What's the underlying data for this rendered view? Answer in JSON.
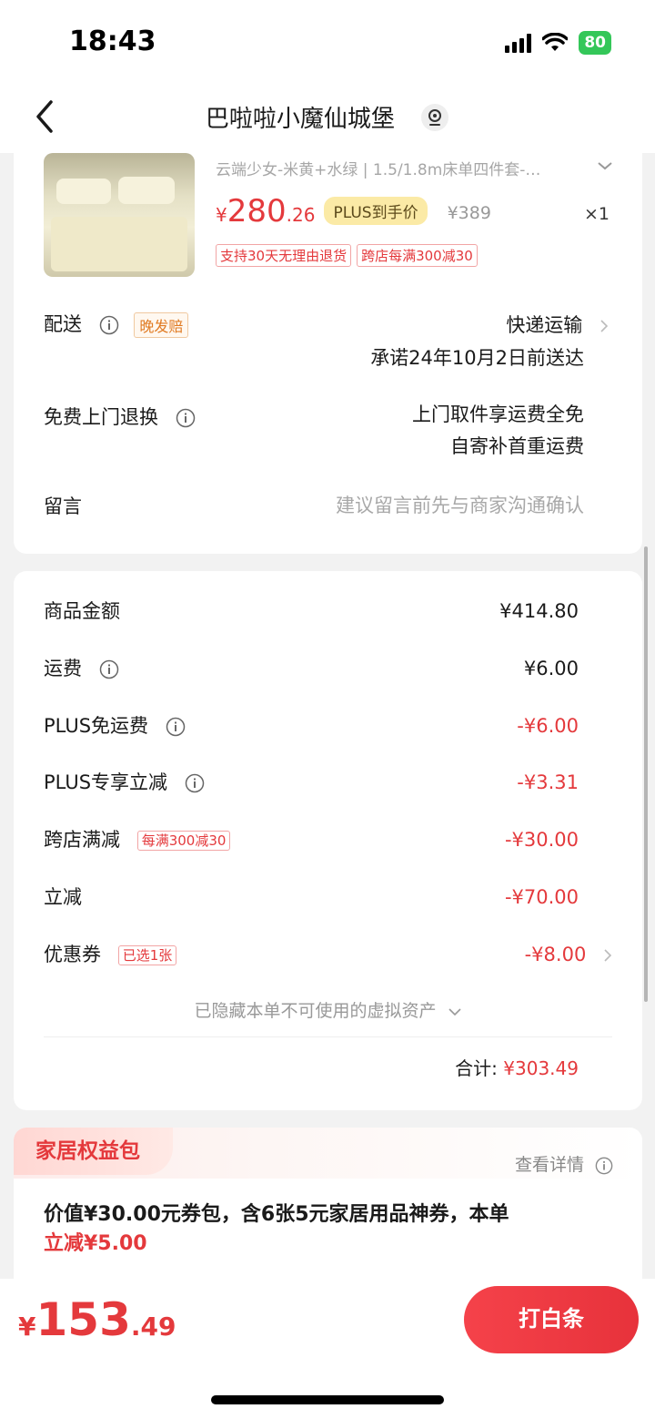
{
  "status": {
    "time": "18:43",
    "battery": "80"
  },
  "nav": {
    "title": "巴啦啦小魔仙城堡"
  },
  "product": {
    "spec": "云端少女-米黄+水绿 | 1.5/1.8m床单四件套-…",
    "price_symbol": "¥",
    "price_int": "280",
    "price_dec": ".26",
    "plus_tag": "PLUS到手价",
    "original_price": "¥389",
    "quantity": "×1",
    "tags": [
      "支持30天无理由退货",
      "跨店每满300减30"
    ]
  },
  "delivery": {
    "label": "配送",
    "badge": "晚发赔",
    "method": "快递运输",
    "promise": "承诺24年10月2日前送达"
  },
  "returns": {
    "label": "免费上门退换",
    "line1": "上门取件享运费全免",
    "line2": "自寄补首重运费"
  },
  "message": {
    "label": "留言",
    "placeholder": "建议留言前先与商家沟通确认"
  },
  "summary": {
    "goods_amount": {
      "label": "商品金额",
      "value": "¥414.80"
    },
    "shipping": {
      "label": "运费",
      "value": "¥6.00"
    },
    "plus_free_shipping": {
      "label": "PLUS免运费",
      "value": "-¥6.00"
    },
    "plus_exclusive": {
      "label": "PLUS专享立减",
      "value": "-¥3.31"
    },
    "cross_store": {
      "label": "跨店满减",
      "tag": "每满300减30",
      "value": "-¥30.00"
    },
    "instant_discount": {
      "label": "立减",
      "value": "-¥70.00"
    },
    "coupon": {
      "label": "优惠券",
      "tag": "已选1张",
      "value": "-¥8.00"
    },
    "hidden_assets": "已隐藏本单不可使用的虚拟资产",
    "total_label": "合计:",
    "total_value": "¥303.49"
  },
  "benefit": {
    "title": "家居权益包",
    "detail": "查看详情",
    "body": "价值¥30.00元券包，含6张5元家居用品神券，本单",
    "body_red": "立减¥5.00"
  },
  "bottom": {
    "price_symbol": "¥",
    "price_int": "153",
    "price_dec": ".49",
    "pay_button": "打白条"
  },
  "colors": {
    "accent": "#e4393c",
    "plus_gold": "#fbeaa6",
    "badge_orange": "#e07a22"
  },
  "icons": [
    "back-icon",
    "location-pin-icon",
    "info-icon",
    "chevron-right-icon",
    "chevron-down-icon",
    "signal-icon",
    "wifi-icon"
  ]
}
